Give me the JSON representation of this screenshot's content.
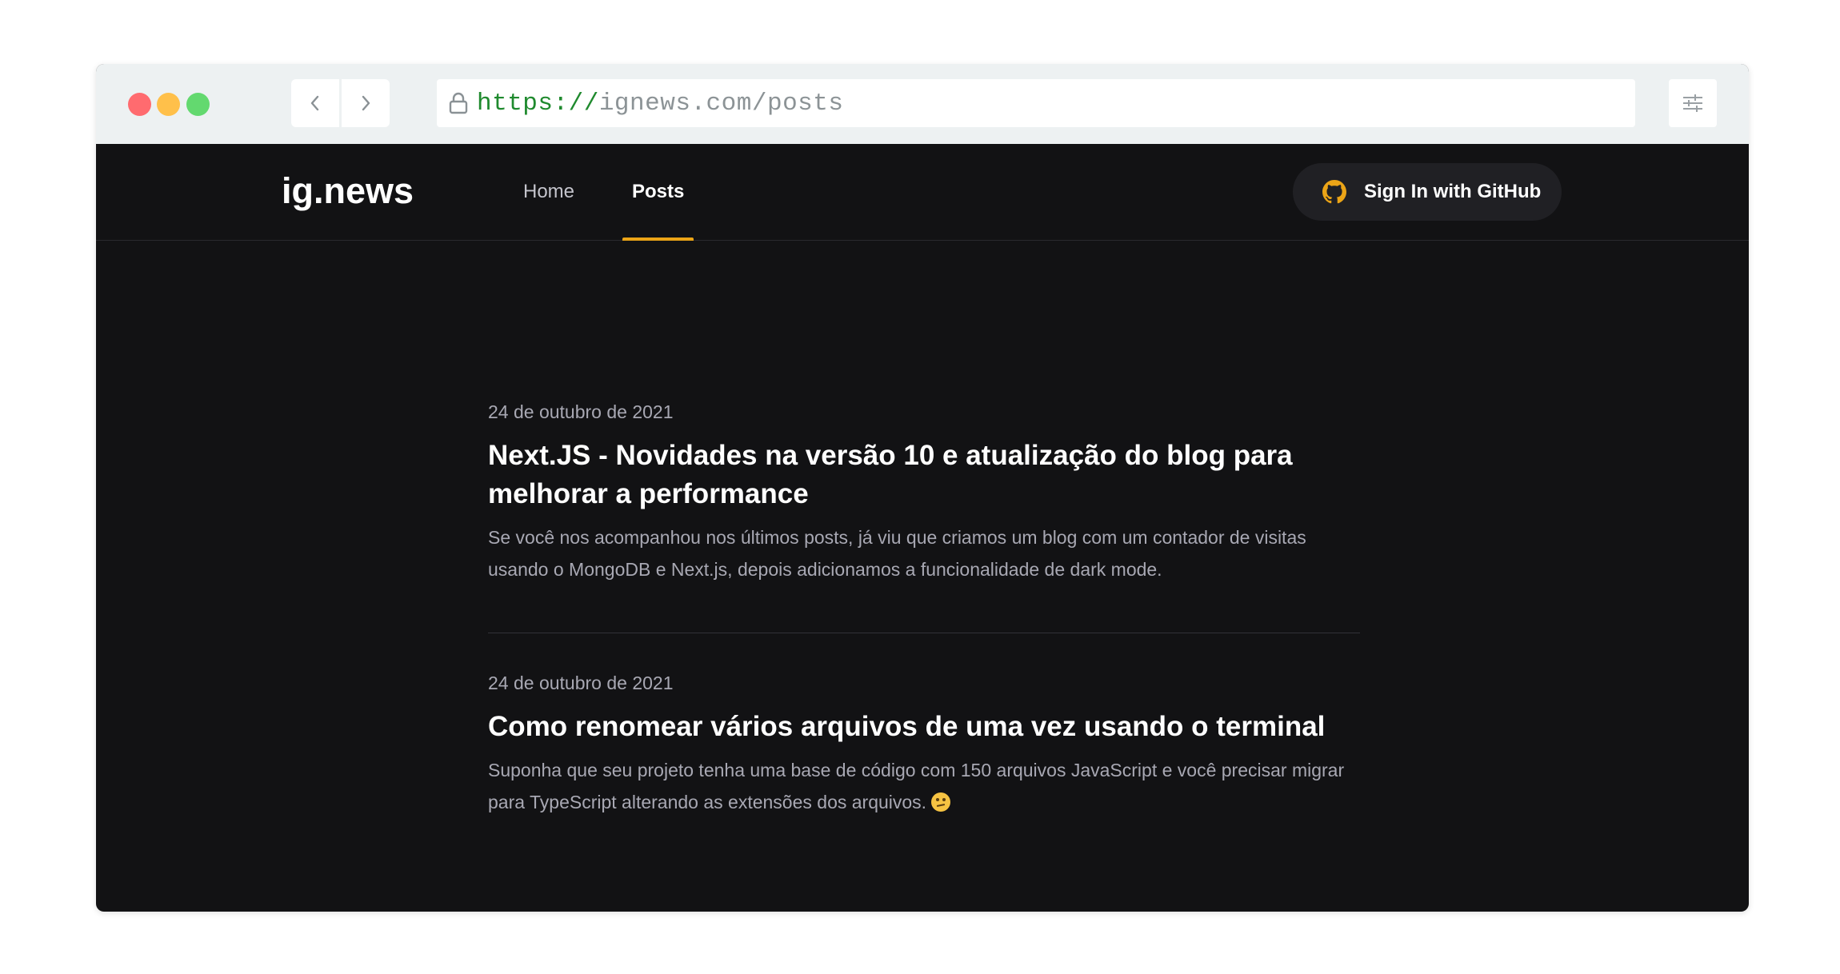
{
  "browser": {
    "url_scheme": "https://",
    "url_rest": "ignews.com/posts",
    "window_controls": [
      "close",
      "minimize",
      "maximize"
    ],
    "icons": {
      "back": "chevron-left-icon",
      "forward": "chevron-right-icon",
      "lock": "lock-icon",
      "settings": "sliders-icon"
    }
  },
  "header": {
    "logo": "ig.news",
    "nav": [
      {
        "label": "Home",
        "active": false
      },
      {
        "label": "Posts",
        "active": true
      }
    ],
    "signin_label": "Sign In with GitHub",
    "signin_icon": "github-icon"
  },
  "posts": [
    {
      "date": "24 de outubro de 2021",
      "title": "Next.JS - Novidades na versão 10 e atualização do blog para melhorar a performance",
      "excerpt": "Se você nos acompanhou nos últimos posts, já viu que criamos um blog com um contador de visitas usando o MongoDB e Next.js, depois adicionamos a funcionalidade de dark mode."
    },
    {
      "date": "24 de outubro de 2021",
      "title": "Como renomear vários arquivos de uma vez usando o terminal",
      "excerpt": "Suponha que seu projeto tenha uma base de código com 150 arquivos JavaScript e você precisar migrar para TypeScript alterando as extensões dos arquivos.",
      "excerpt_emoji": "thinking-face-emoji"
    }
  ],
  "colors": {
    "page_bg": "#121214",
    "accent": "#eba417",
    "header_button_bg": "#202024",
    "muted_text": "#a8a8b3"
  }
}
